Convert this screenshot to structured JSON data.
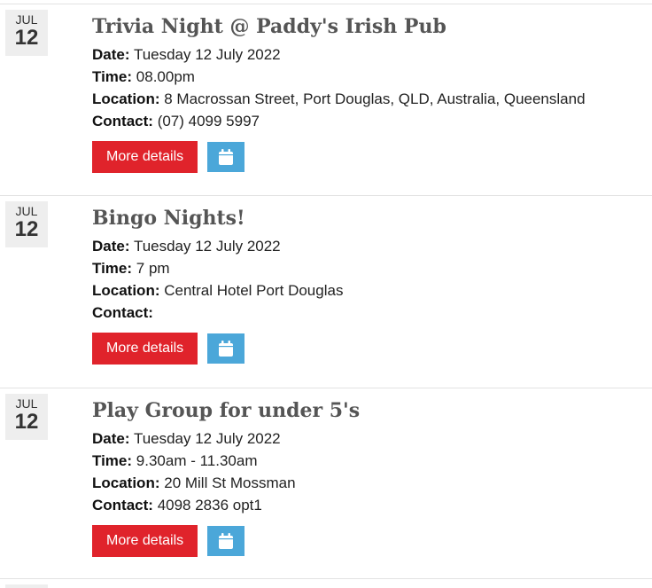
{
  "events": [
    {
      "month": "JUL",
      "day": "12",
      "title": "Trivia Night @ Paddy's Irish Pub",
      "date_label": "Date:",
      "date": "Tuesday 12 July 2022",
      "time_label": "Time:",
      "time": "08.00pm",
      "location_label": "Location:",
      "location": "8 Macrossan Street, Port Douglas, QLD, Australia, Queensland",
      "contact_label": "Contact:",
      "contact": "(07) 4099 5997",
      "details_label": "More details",
      "calendar_icon": "calendar-icon"
    },
    {
      "month": "JUL",
      "day": "12",
      "title": "Bingo Nights!",
      "date_label": "Date:",
      "date": "Tuesday 12 July 2022",
      "time_label": "Time:",
      "time": "7 pm",
      "location_label": "Location:",
      "location": "Central Hotel Port Douglas",
      "contact_label": "Contact:",
      "contact": "",
      "details_label": "More details",
      "calendar_icon": "calendar-icon"
    },
    {
      "month": "JUL",
      "day": "12",
      "title": "Play Group for under 5's",
      "date_label": "Date:",
      "date": "Tuesday 12 July 2022",
      "time_label": "Time:",
      "time": "9.30am - 11.30am",
      "location_label": "Location:",
      "location": "20 Mill St Mossman",
      "contact_label": "Contact:",
      "contact": "4098 2836 opt1",
      "details_label": "More details",
      "calendar_icon": "calendar-icon"
    }
  ],
  "colors": {
    "details_button": "#e0232b",
    "calendar_button": "#4ba7d9",
    "date_badge": "#eeeeee",
    "title": "#555555"
  }
}
